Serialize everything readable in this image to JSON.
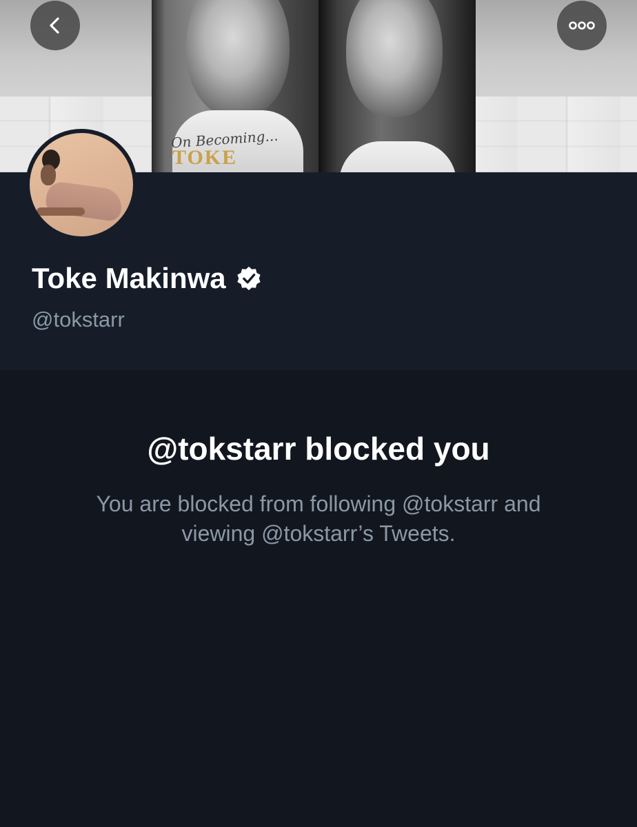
{
  "nav": {
    "back_icon": "chevron-left-icon",
    "more_icon": "more-horizontal-icon"
  },
  "banner": {
    "book_subtitle": "On Becoming...",
    "book_name": "TOKE"
  },
  "profile": {
    "display_name": "Toke Makinwa",
    "verified_icon": "verified-badge-icon",
    "handle": "@tokstarr"
  },
  "blocked": {
    "title": "@tokstarr blocked you",
    "message_line1": "You are blocked from following @tokstarr and",
    "message_line2": "viewing @tokstarr’s Tweets."
  },
  "colors": {
    "background": "#12161f",
    "profile_bg": "#161d29",
    "secondary_text": "#8b98a6",
    "primary_text": "#ffffff"
  }
}
